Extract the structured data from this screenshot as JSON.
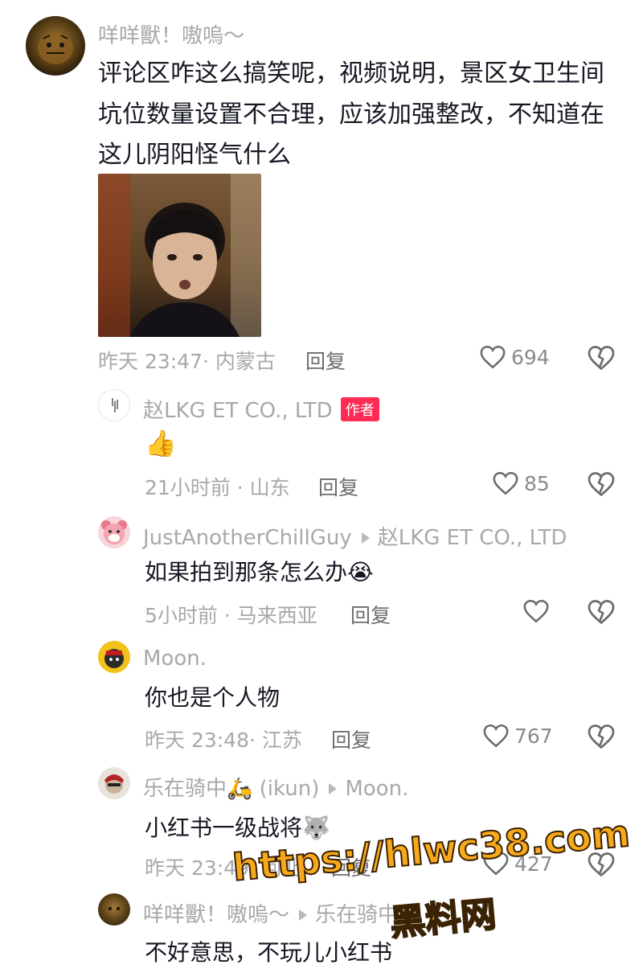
{
  "comments": [
    {
      "username": "咩咩獸！嗷嗚～",
      "text_lines": [
        "评论区咋这么搞笑呢，视频说明，景区女卫生间",
        "坑位数量设置不合理，应该加强整改，不知道在",
        "这儿阴阳怪气什么"
      ],
      "time_location": "昨天 23:47· 内蒙古",
      "reply_label": "回复",
      "likes": "694"
    },
    {
      "username": "赵LKG ET CO., LTD",
      "author_badge": "作者",
      "text": "👍",
      "time_location": "21小时前 · 山东",
      "reply_label": "回复",
      "likes": "85"
    },
    {
      "username": "JustAnotherChillGuy",
      "reply_to": "赵LKG ET CO., LTD",
      "text": "如果拍到那条怎么办😭",
      "time_location": "5小时前 · 马来西亚",
      "reply_label": "回复",
      "likes": ""
    },
    {
      "username": "Moon.",
      "text": "你也是个人物",
      "time_location": "昨天 23:48· 江苏",
      "reply_label": "回复",
      "likes": "767"
    },
    {
      "username": "乐在骑中🛵 (ikun)",
      "reply_to": "Moon.",
      "text": "小红书一级战将🐺",
      "time_location": "昨天 23:49· 河北",
      "reply_label": "回复",
      "likes": "427"
    },
    {
      "username": "咩咩獸！嗷嗚～",
      "reply_to": "乐在骑中",
      "text": "不好意思，不玩儿小红书",
      "time_location": "",
      "reply_label": "",
      "likes": ""
    }
  ],
  "watermark": {
    "url": "https://hlwc38.com",
    "label": "黑料网"
  },
  "colors": {
    "username": "#a8a8ad",
    "text": "#161823",
    "badge": "#fe2c55",
    "watermark": "#f7a91c"
  }
}
